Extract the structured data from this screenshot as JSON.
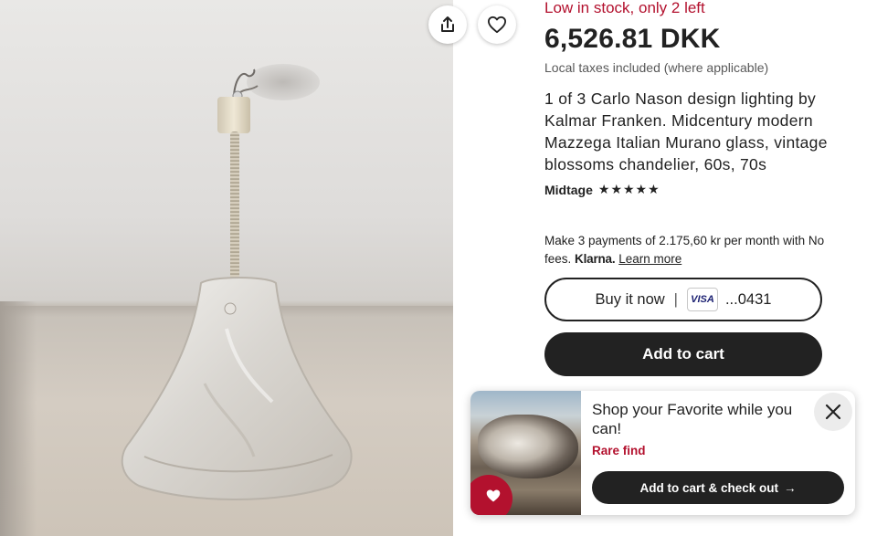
{
  "product": {
    "stock_notice": "Low in stock, only 2 left",
    "price": "6,526.81 DKK",
    "taxes_note": "Local taxes included (where applicable)",
    "title": "1 of 3 Carlo Nason design lighting by Kalmar Franken. Midcentury modern Mazzega Italian Murano glass, vintage blossoms chandelier, 60s, 70s",
    "shop_name": "Midtage",
    "rating_stars": "★★★★★",
    "rating_value": 5
  },
  "payments": {
    "klarna_text": "Make 3 payments of 2.175,60 kr per month with No fees.",
    "klarna_logo": "Klarna.",
    "learn_more": "Learn more"
  },
  "buttons": {
    "buy_now": "Buy it now",
    "separator": "|",
    "card_brand": "VISA",
    "card_digits": "...0431",
    "add_to_cart": "Add to cart"
  },
  "popup": {
    "title": "Shop your Favorite while you can!",
    "subtitle": "Rare find",
    "cta": "Add to cart & check out",
    "cta_arrow": "→"
  },
  "icons": {
    "share": "share-icon",
    "favorite": "heart-icon",
    "close": "close-icon",
    "popup_badge": "heart-filled-icon"
  },
  "colors": {
    "accent_red": "#b3112e",
    "primary_dark": "#222222",
    "muted_text": "#595959"
  }
}
